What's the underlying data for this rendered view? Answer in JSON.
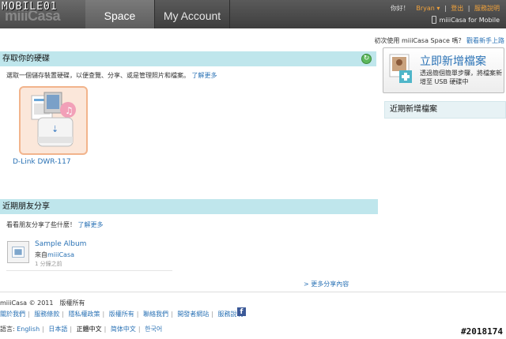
{
  "header": {
    "logo": "miiiCasa",
    "watermark": "MOBILE01",
    "tabs": [
      {
        "label": "Space",
        "active": true
      },
      {
        "label": "My Account",
        "active": false
      }
    ],
    "greeting": "你好！",
    "user": "Bryan",
    "logout": "登出",
    "help": "服務說明",
    "mobile_link": "miiiCasa for Mobile"
  },
  "intro": {
    "text": "初次使用 miiiCasa Space 嗎？",
    "link": "觀看新手上路"
  },
  "storage": {
    "title": "存取你的硬碟",
    "desc": "選取一個儲存裝置硬碟，以便查覽、分享、或是管理照片和檔案。",
    "learn_more": "了解更多",
    "device_name": "D-Link DWR-117"
  },
  "shares": {
    "title": "近期朋友分享",
    "desc": "看看朋友分享了些什麼！",
    "learn_more": "了解更多",
    "item": {
      "title": "Sample Album",
      "from_prefix": "來自",
      "from_name": "miiiCasa",
      "time": "1 分鐘之前"
    },
    "more": "> 更多分享內容"
  },
  "sidebar": {
    "upload_title": "立即新增檔案",
    "upload_desc": "透過簡個簡單步驟，將檔案新增至 USB 硬碟中",
    "recent_title": "近期新增檔案"
  },
  "footer": {
    "copyright": "miiiCasa © 2011　版權所有",
    "links": [
      "關於我們",
      "服務條款",
      "隱私權政策",
      "版權所有",
      "聯絡我們",
      "開發者網站",
      "服務說明"
    ],
    "lang_label": "語言:",
    "languages": [
      {
        "label": "English",
        "current": false
      },
      {
        "label": "日本語",
        "current": false
      },
      {
        "label": "正體中文",
        "current": true
      },
      {
        "label": "简体中文",
        "current": false
      },
      {
        "label": "한국어",
        "current": false
      }
    ]
  },
  "photo_watermark": "#2018174",
  "colors": {
    "accent_link": "#2a72b5",
    "section_header": "#bfe6ec",
    "top_link": "#f2a33c"
  }
}
